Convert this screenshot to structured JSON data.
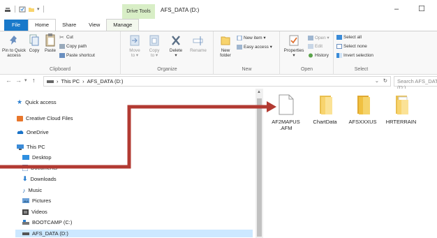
{
  "window": {
    "title": "AFS_DATA (D:)",
    "contextual_tab_group": "Drive Tools",
    "minimize_label": "–",
    "maximize_label": "☐"
  },
  "tabs": [
    {
      "label": "File"
    },
    {
      "label": "Home"
    },
    {
      "label": "Share"
    },
    {
      "label": "View"
    },
    {
      "label": "Manage"
    }
  ],
  "ribbon": {
    "clipboard": {
      "label": "Clipboard",
      "pin_to_quick_access_line1": "Pin to Quick",
      "pin_to_quick_access_line2": "access",
      "copy": "Copy",
      "paste": "Paste",
      "cut": "Cut",
      "copy_path": "Copy path",
      "paste_shortcut": "Paste shortcut"
    },
    "organize": {
      "label": "Organize",
      "move_to_line1": "Move",
      "move_to_line2": "to ▾",
      "copy_to_line1": "Copy",
      "copy_to_line2": "to ▾",
      "delete_line1": "Delete",
      "delete_line2": "▾",
      "rename": "Rename"
    },
    "new": {
      "label": "New",
      "new_folder_line1": "New",
      "new_folder_line2": "folder",
      "new_item": "New item ▾",
      "easy_access": "Easy access ▾"
    },
    "open": {
      "label": "Open",
      "properties_line1": "Properties",
      "properties_line2": "▾",
      "open": "Open ▾",
      "edit": "Edit",
      "history": "History"
    },
    "select": {
      "label": "Select",
      "select_all": "Select all",
      "select_none": "Select none",
      "invert_selection": "Invert selection"
    }
  },
  "address": {
    "back": "←",
    "forward": "→",
    "recent": "▾",
    "up": "↑",
    "crumbs": [
      "This PC",
      "AFS_DATA (D:)"
    ],
    "separator": "›",
    "dropdown": "⌄",
    "refresh": "↻",
    "search_placeholder": "Search AFS_DATA (D:)"
  },
  "nav_pane": {
    "items": [
      {
        "label": "Quick access",
        "icon": "star-icon"
      },
      {
        "label": "Creative Cloud Files",
        "icon": "creative-cloud-icon"
      },
      {
        "label": "OneDrive",
        "icon": "cloud-icon"
      },
      {
        "label": "This PC",
        "icon": "computer-icon"
      },
      {
        "label": "Desktop",
        "icon": "desktop-icon"
      },
      {
        "label": "Documents",
        "icon": "documents-icon"
      },
      {
        "label": "Downloads",
        "icon": "download-icon"
      },
      {
        "label": "Music",
        "icon": "music-icon"
      },
      {
        "label": "Pictures",
        "icon": "pictures-icon"
      },
      {
        "label": "Videos",
        "icon": "videos-icon"
      },
      {
        "label": "BOOTCAMP (C:)",
        "icon": "drive-icon"
      },
      {
        "label": "AFS_DATA (D:)",
        "icon": "drive-icon",
        "selected": true
      }
    ]
  },
  "files": [
    {
      "name_line1": "AF2MAPUS",
      "name_line2": ".AFM",
      "type": "file"
    },
    {
      "name_line1": "ChartData",
      "name_line2": "",
      "type": "folder"
    },
    {
      "name_line1": "AFSXXXUS",
      "name_line2": "",
      "type": "folder"
    },
    {
      "name_line1": "HRTERRAIN",
      "name_line2": "",
      "type": "folder"
    }
  ],
  "colors": {
    "accent": "#1979ca",
    "drive_tools": "#d8eec6",
    "selection": "#cce8ff",
    "folder": "#f8d46e",
    "annotation_arrow": "#b23a32"
  }
}
